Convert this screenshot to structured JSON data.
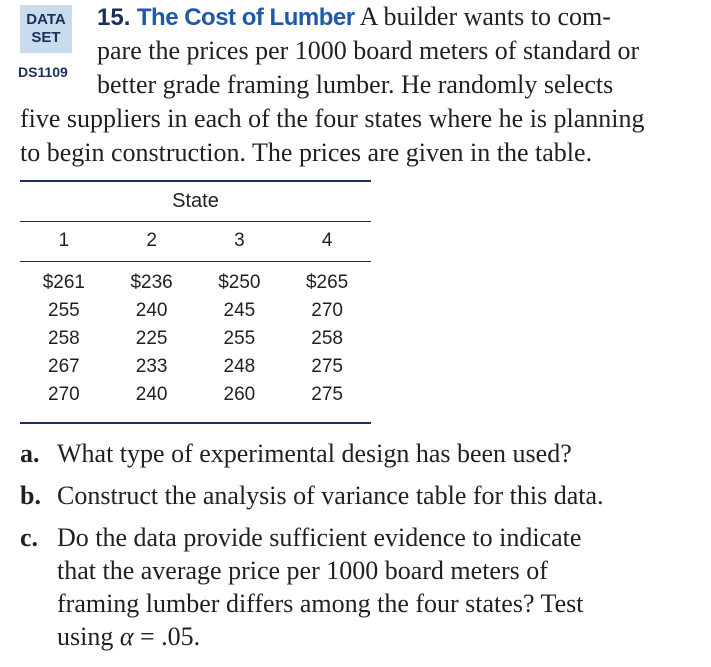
{
  "badge": {
    "line1": "DATA",
    "line2": "SET",
    "id": "DS1109"
  },
  "problem": {
    "number": "15.",
    "title": "The Cost of Lumber",
    "lines": [
      "A builder wants to com-",
      "pare the prices per 1000 board meters of standard or",
      "better grade framing lumber. He randomly selects",
      "five suppliers in each of the four states where he is planning",
      "to begin construction. The prices are given in the table."
    ]
  },
  "table": {
    "group_label": "State",
    "columns": [
      "1",
      "2",
      "3",
      "4"
    ],
    "rows": [
      [
        "$261",
        "$236",
        "$250",
        "$265"
      ],
      [
        "255",
        "240",
        "245",
        "270"
      ],
      [
        "258",
        "225",
        "255",
        "258"
      ],
      [
        "267",
        "233",
        "248",
        "275"
      ],
      [
        "270",
        "240",
        "260",
        "275"
      ]
    ]
  },
  "questions": [
    {
      "label": "a.",
      "lines": [
        "What type of experimental design has been used?"
      ]
    },
    {
      "label": "b.",
      "lines": [
        "Construct the analysis of variance table for this data."
      ]
    },
    {
      "label": "c.",
      "lines": [
        "Do the data provide sufficient evidence to indicate",
        "that the average price per 1000 board meters of",
        "framing lumber differs among the four states? Test"
      ],
      "last_prefix": "using ",
      "alpha_symbol": "α",
      "last_suffix": " = .05."
    }
  ],
  "colors": {
    "badge_bg": "#c9dcee",
    "navy": "#1a2f5e",
    "title_blue": "#1e5aa8",
    "text": "#231f20"
  }
}
